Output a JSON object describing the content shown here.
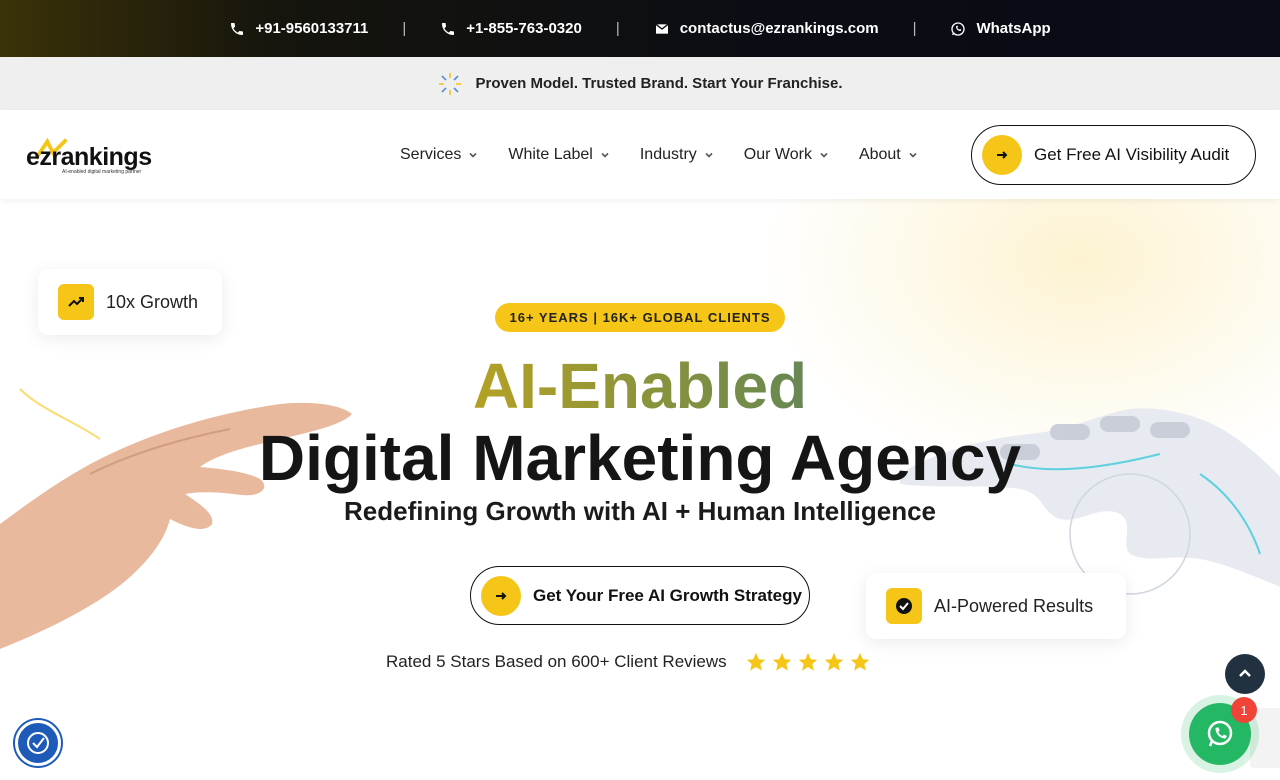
{
  "topbar": {
    "phone_in": "+91-9560133711",
    "phone_us": "+1-855-763-0320",
    "email": "contactus@ezrankings.com",
    "whatsapp": "WhatsApp",
    "separator": "|"
  },
  "promo": {
    "text": "Proven Model. Trusted Brand. Start Your Franchise."
  },
  "nav": {
    "logo_text": "ezrankings",
    "logo_tagline": "AI-enabled digital marketing partner",
    "items": [
      {
        "label": "Services"
      },
      {
        "label": "White Label"
      },
      {
        "label": "Industry"
      },
      {
        "label": "Our Work"
      },
      {
        "label": "About"
      }
    ],
    "cta_label": "Get Free AI Visibility Audit"
  },
  "hero": {
    "badge": "16+ YEARS | 16K+ GLOBAL CLIENTS",
    "headline_accent": "AI-Enabled",
    "headline_main": "Digital Marketing Agency",
    "subheadline": "Redefining Growth with AI + Human Intelligence",
    "cta_label": "Get Your Free AI Growth Strategy",
    "rating_text": "Rated 5 Stars Based on 600+ Client Reviews",
    "stars": 5,
    "card_growth": "10x Growth",
    "card_ai": "AI-Powered Results"
  },
  "widgets": {
    "whatsapp_unread": "1"
  },
  "colors": {
    "accent": "#f5c518",
    "dark": "#111111",
    "whatsapp": "#25b864",
    "scroll_top": "#22313f",
    "accessibility": "#1e5bb8"
  }
}
